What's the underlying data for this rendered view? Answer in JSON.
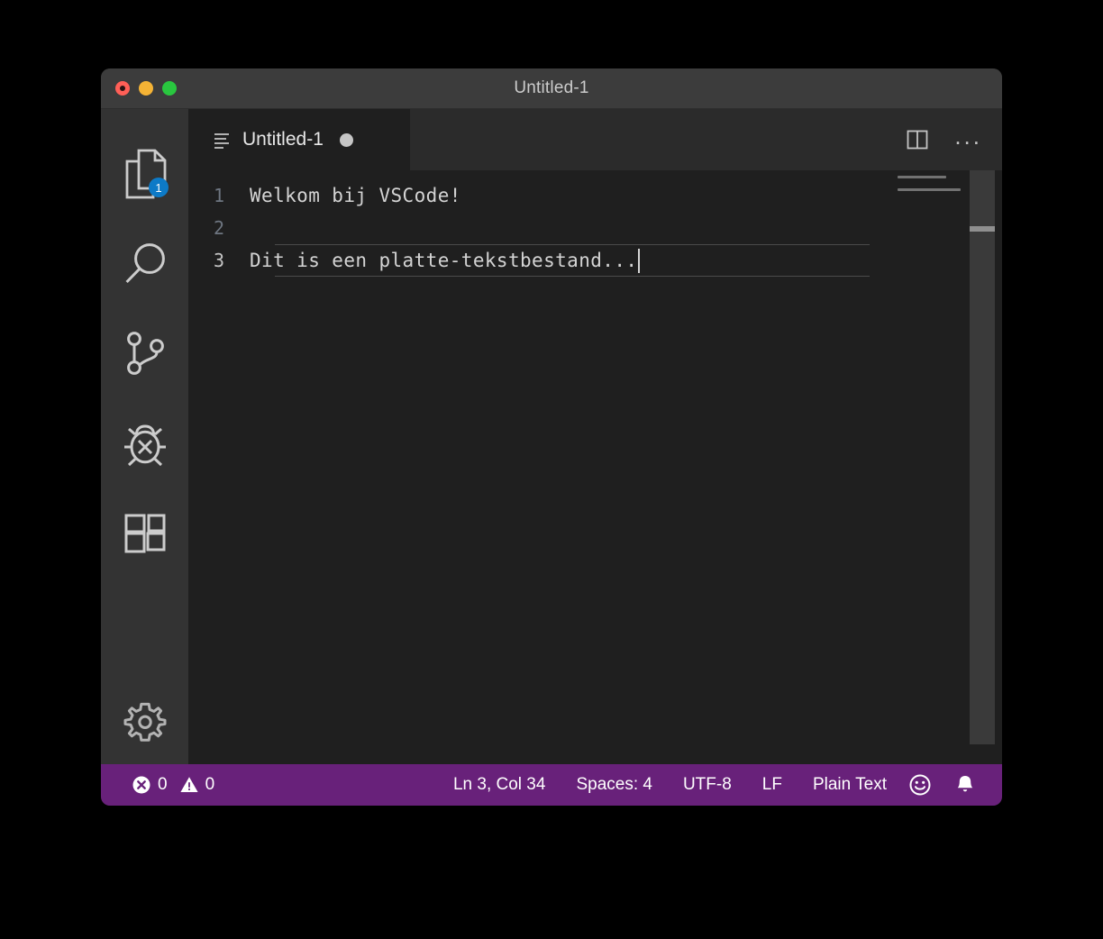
{
  "window": {
    "title": "Untitled-1",
    "traffic_lights": [
      "close-button",
      "minimize-button",
      "maximize-button"
    ]
  },
  "activity_bar": {
    "items": [
      {
        "name": "explorer",
        "icon": "files-icon",
        "badge": "1"
      },
      {
        "name": "search",
        "icon": "search-icon",
        "badge": ""
      },
      {
        "name": "source-control",
        "icon": "source-control-icon",
        "badge": ""
      },
      {
        "name": "run-and-debug",
        "icon": "debug-icon",
        "badge": ""
      },
      {
        "name": "extensions",
        "icon": "extensions-icon",
        "badge": ""
      }
    ],
    "bottom_items": [
      {
        "name": "manage-settings",
        "icon": "gear-icon"
      }
    ]
  },
  "tabs": {
    "active": {
      "label": "Untitled-1",
      "icon": "plaintext-file-icon",
      "dirty": true
    }
  },
  "editor_actions": {
    "split_editor": "split-editor-icon",
    "more_actions": "..."
  },
  "editor": {
    "lines": [
      {
        "number": "1",
        "text": "Welkom bij VSCode!",
        "current": false
      },
      {
        "number": "2",
        "text": "",
        "current": false
      },
      {
        "number": "3",
        "text": "Dit is een platte-tekstbestand...",
        "current": true
      }
    ],
    "minimap_enabled": true
  },
  "status_bar": {
    "background": "#68217a",
    "errors": {
      "icon": "error-icon",
      "count": "0"
    },
    "warnings": {
      "icon": "warning-icon",
      "count": "0"
    },
    "cursor_position": "Ln 3, Col 34",
    "indentation": "Spaces: 4",
    "encoding": "UTF-8",
    "line_ending": "LF",
    "language_mode": "Plain Text",
    "feedback": "smiley-icon",
    "notifications": "bell-icon"
  },
  "colors": {
    "titlebar": "#3c3c3c",
    "activitybar": "#333333",
    "editor_background": "#1f1f1f",
    "tabbar": "#2b2b2b",
    "status_purple": "#68217a",
    "badge_blue": "#0d7ac7",
    "text": "#d4d4d4"
  }
}
